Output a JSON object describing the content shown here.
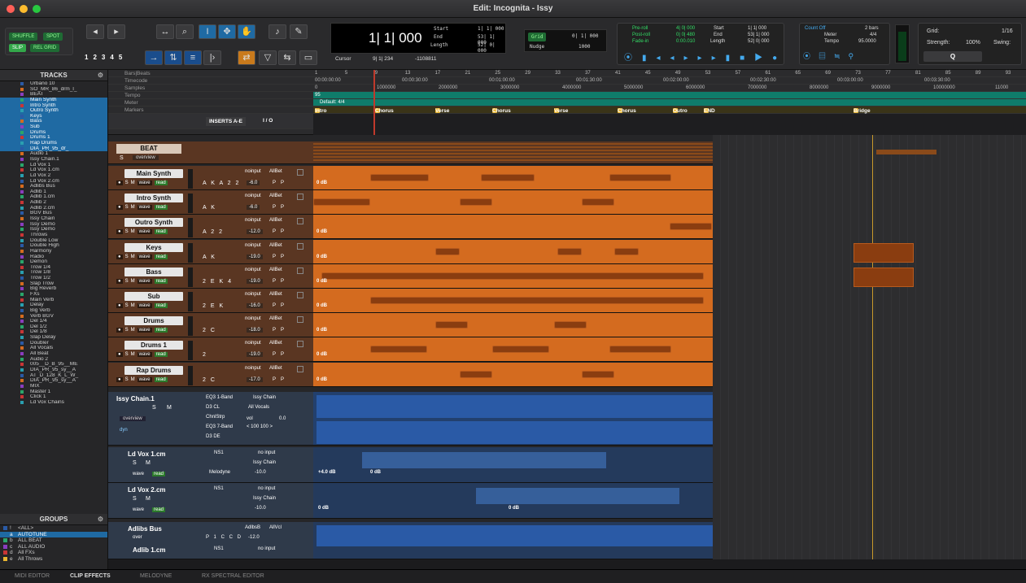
{
  "window": {
    "title": "Edit: Incognita - Issy"
  },
  "modes": {
    "shuffle": "SHUFFLE",
    "spot": "SPOT",
    "slip": "SLIP",
    "relgrid": "REL GRID"
  },
  "zoom_presets": [
    "1",
    "2",
    "3",
    "4",
    "5"
  ],
  "counter": {
    "main": "1| 1| 000",
    "start": "1| 1| 000",
    "end": "53| 1| 000",
    "length": "52| 0| 000",
    "start_label": "Start",
    "end_label": "End",
    "length_label": "Length",
    "cursor_label": "Cursor",
    "cursor": "9| 1| 234",
    "sample": "-1108811"
  },
  "grid": {
    "label": "Grid",
    "value": "0| 1| 000",
    "nudge_label": "Nudge",
    "nudge": "1000"
  },
  "prepost": {
    "preroll_label": "Pre-roll",
    "preroll": "4| 0| 000",
    "postroll_label": "Post-roll",
    "postroll": "0| 0| 480",
    "fadein_label": "Fade-in",
    "fadein": "0:00.010",
    "start_label": "Start",
    "start": "1| 1| 000",
    "end_label": "End",
    "end": "53| 1| 000",
    "length_label": "Length",
    "length": "52| 0| 000"
  },
  "count": {
    "countoff": "Count Off",
    "bars": "2 bars",
    "meter_label": "Meter",
    "meter": "4/4",
    "tempo_label": "Tempo",
    "tempo": "95.0000"
  },
  "gridpanel": {
    "grid_label": "Grid:",
    "grid": "1/16",
    "strength_label": "Strength:",
    "strength": "100%",
    "swing_label": "Swing:"
  },
  "tracks_panel": {
    "title": "TRACKS",
    "items": [
      "Urbano 10",
      "SO_MR_86_drm_l_",
      "BEAT",
      "Main Synth",
      "Intro Synth",
      "Outro Synth",
      "Keys",
      "Bass",
      "Sub",
      "Drums",
      "Drums 1",
      "Rap Drums",
      "DIA_PR_95_dr_",
      "Audio 1",
      "Issy Chain.1",
      "Ld Vox 1",
      "Ld Vox 1.cm",
      "Ld Vox 2",
      "Ld Vox 2.cm",
      "Adlibs Bus",
      "Adlib 1",
      "Adlib 1.cm",
      "Adlib 2",
      "Adlib 2.cm",
      "BGV Bus",
      "Issy Chain",
      "Issy Demo",
      "Issy Demo",
      "Throws",
      "Double Low",
      "Double High",
      "Harmony",
      "Radio",
      "Demon",
      "Trow 1/4",
      "Trow 1/8",
      "Trow 1/2",
      "Slap Trow",
      "Big Reverb",
      "FXs",
      "Main Verb",
      "Delay",
      "Big Verb",
      "Verb BGV",
      "Del 1/4",
      "Del 1/2",
      "Del 1/8",
      "Slap Delay",
      "Doubler",
      "All Vocals",
      "All Beat",
      "Audio 2",
      "005__D_B_95__ME",
      "DIA_PR_95_sy__A",
      "AT_D_128_K_L_W_",
      "DIA_PR_95_sy__A",
      "MIX",
      "Master 1",
      "Click 1",
      "Ld Vox Chains"
    ]
  },
  "groups_panel": {
    "title": "GROUPS",
    "items": [
      {
        "id": "!",
        "name": "<ALL>"
      },
      {
        "id": "a",
        "name": "AUTOTUNE"
      },
      {
        "id": "b",
        "name": "ALL BEAT"
      },
      {
        "id": "c",
        "name": "ALL AUDIO"
      },
      {
        "id": "d",
        "name": "All FXs"
      },
      {
        "id": "e",
        "name": "All Throws"
      }
    ]
  },
  "rulers": {
    "bars": "Bars|Beats",
    "timecode": "Timecode",
    "samples": "Samples",
    "tempo": "Tempo",
    "meter": "Meter",
    "markers": "Markers",
    "tempo_value": "95",
    "meter_value": "Default: 4/4"
  },
  "bar_numbers": [
    "1",
    "5",
    "9",
    "13",
    "17",
    "21",
    "25",
    "29",
    "33",
    "37",
    "41",
    "45",
    "49",
    "53",
    "57",
    "61",
    "65",
    "69",
    "73",
    "77",
    "81",
    "85",
    "89",
    "93"
  ],
  "timecodes": [
    "00:00:00:00",
    "00:00:30:00",
    "00:01:00:00",
    "00:01:30:00",
    "00:02:00:00",
    "00:02:30:00",
    "00:03:00:00",
    "00:03:30:00"
  ],
  "samples": [
    "0",
    "1000000",
    "2000000",
    "3000000",
    "4000000",
    "5000000",
    "6000000",
    "7000000",
    "8000000",
    "9000000",
    "10000000",
    "11000"
  ],
  "markers": [
    "Intro",
    "Chorus",
    "Verse",
    "Chorus",
    "Verse",
    "Chorus",
    "Outro",
    "END",
    "Bridge"
  ],
  "column_heads": {
    "inserts": "INSERTS A-E",
    "io": "I / O"
  },
  "folder": {
    "name": "BEAT",
    "view": "overview"
  },
  "audio_tracks": [
    {
      "name": "Main Synth",
      "io": "noinput",
      "bus": "AllBet",
      "vol": "-6.0",
      "ins": "A K A 2 2",
      "gain": "0 dB"
    },
    {
      "name": "Intro Synth",
      "io": "noinput",
      "bus": "AllBet",
      "vol": "-6.0",
      "ins": "A K",
      "gain": ""
    },
    {
      "name": "Outro Synth",
      "io": "noinput",
      "bus": "AllBet",
      "vol": "-12.0",
      "ins": "A 2 2",
      "gain": "0 dB"
    },
    {
      "name": "Keys",
      "io": "noinput",
      "bus": "AllBet",
      "vol": "-19.0",
      "ins": "A K",
      "gain": "0 dB"
    },
    {
      "name": "Bass",
      "io": "noinput",
      "bus": "AllBet",
      "vol": "-19.0",
      "ins": "2 E K 4",
      "gain": "0 dB"
    },
    {
      "name": "Sub",
      "io": "noinput",
      "bus": "AllBet",
      "vol": "-16.0",
      "ins": "2 E K",
      "gain": "0 dB"
    },
    {
      "name": "Drums",
      "io": "noinput",
      "bus": "AllBet",
      "vol": "-18.0",
      "ins": "2 C",
      "gain": "0 dB"
    },
    {
      "name": "Drums 1",
      "io": "noinput",
      "bus": "AllBet",
      "vol": "-19.0",
      "ins": "2",
      "gain": "0 dB"
    },
    {
      "name": "Rap Drums",
      "io": "noinput",
      "bus": "AllBet",
      "vol": "-17.0",
      "ins": "2 C",
      "gain": "0 dB"
    }
  ],
  "track_labels": {
    "solo": "S",
    "mute": "M",
    "wave": "wave",
    "read": "read",
    "p": "P"
  },
  "issy_chain": {
    "name": "Issy Chain.1",
    "ins1": "EQ3 1-Band",
    "ins2": "D3 CL",
    "ins3": "ChnlStrp",
    "ins4": "EQ3 7-Band",
    "ins5": "D3 DE",
    "out": "Issy Chain",
    "bus": "All Vocals",
    "vol_label": "vol",
    "vol": "0.0",
    "pan": "< 100  100 >",
    "view": "overview",
    "dyn": "dyn"
  },
  "vox": [
    {
      "name": "Ld Vox 1.cm",
      "ins": "NS1",
      "ins2": "Melodyne",
      "io": "no input",
      "out": "Issy Chain",
      "vol": "-10.0",
      "gain": "+4.0 dB",
      "gain2": "0 dB"
    },
    {
      "name": "Ld Vox 2.cm",
      "ins": "NS1",
      "ins2": "",
      "io": "no input",
      "out": "Issy Chain",
      "vol": "-10.0",
      "gain": "0 dB",
      "gain2": "0 dB"
    }
  ],
  "adlibs": {
    "name": "Adlibs Bus",
    "out": "AdlbsB",
    "bus": "AllVcl",
    "vol": "-12.0",
    "ins": "P 1 C C D",
    "view": "over",
    "next": "Adlib 1.cm",
    "next_ins": "NS1",
    "next_io": "no input"
  },
  "bottom_tabs": [
    "MIDI EDITOR",
    "CLIP EFFECTS",
    "MELODYNE",
    "RX SPECTRAL EDITOR"
  ],
  "colors": {
    "orange": "#d46b1f",
    "blue": "#2a5aa6",
    "select": "#1f6aa3",
    "marker": "#e9b631"
  }
}
